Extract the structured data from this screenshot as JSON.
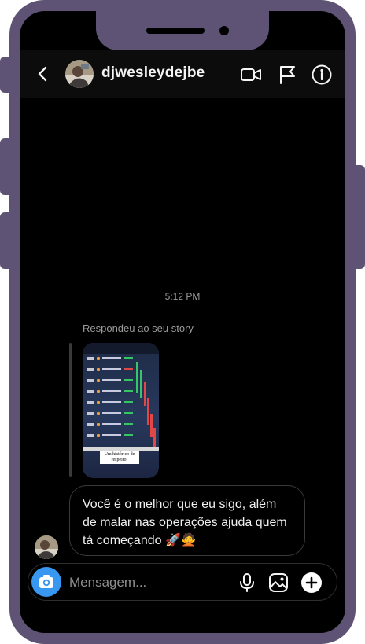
{
  "header": {
    "username": "djwesleydejbe",
    "back_icon": "chevron-left-icon",
    "video_icon": "video-camera-icon",
    "flag_icon": "flag-icon",
    "info_icon": "info-icon"
  },
  "thread": {
    "timestamp": "5:12 PM",
    "story_reply_label": "Respondeu ao seu story",
    "story_caption": "Um histórico de respeito!",
    "message": "Você é o melhor que eu sigo, além de malar nas operações ajuda quem tá começando 🚀🙅"
  },
  "composer": {
    "placeholder": "Mensagem...",
    "camera_icon": "camera-icon",
    "mic_icon": "microphone-icon",
    "gallery_icon": "gallery-icon",
    "plus_icon": "plus-icon"
  },
  "colors": {
    "frame": "#5e5374",
    "screen": "#000000",
    "accent": "#3897f0"
  }
}
